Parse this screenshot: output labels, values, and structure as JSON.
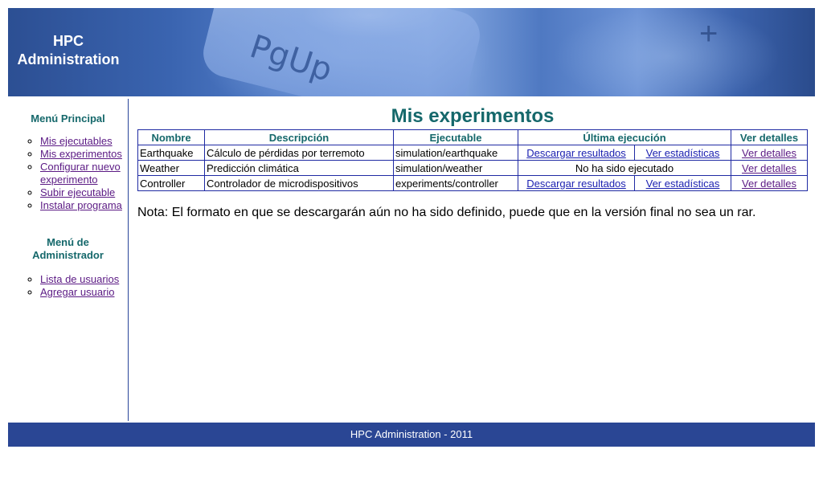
{
  "header": {
    "brand_line1": "HPC",
    "brand_line2": "Administration",
    "banner_key_text": "PgUp",
    "banner_key_symbol": "+"
  },
  "sidebar": {
    "main_menu_title": "Menú Principal",
    "main_menu": [
      "Mis ejecutables",
      "Mis experimentos",
      "Configurar nuevo experimento",
      "Subir ejecutable",
      "Instalar programa"
    ],
    "admin_menu_title_line1": "Menú de",
    "admin_menu_title_line2": "Administrador",
    "admin_menu": [
      "Lista de usuarios",
      "Agregar usuario"
    ]
  },
  "main": {
    "title": "Mis experimentos",
    "columns": [
      "Nombre",
      "Descripción",
      "Ejecutable",
      "Última ejecución",
      "Ver detalles"
    ],
    "rows": [
      {
        "name": "Earthquake",
        "description": "Cálculo de pérdidas por terremoto",
        "executable": "simulation/earthquake",
        "download": "Descargar resultados",
        "stats": "Ver estadísticas",
        "details": "Ver detalles"
      },
      {
        "name": "Weather",
        "description": "Predicción climática",
        "executable": "simulation/weather",
        "status": "No ha sido ejecutado",
        "details": "Ver detalles"
      },
      {
        "name": "Controller",
        "description": "Controlador de microdispositivos",
        "executable": "experiments/controller",
        "download": "Descargar resultados",
        "stats": "Ver estadísticas",
        "details": "Ver detalles"
      }
    ],
    "note": "Nota: El formato en que se descargarán aún no ha sido definido, puede que en la versión final no sea un rar."
  },
  "footer": {
    "text": "HPC Administration - 2011"
  },
  "colors": {
    "heading": "#15686b",
    "footer_bg": "#2a4694",
    "link": "#1a1fb0",
    "visited_link": "#5b1a84",
    "table_border": "#1f2aa3"
  }
}
